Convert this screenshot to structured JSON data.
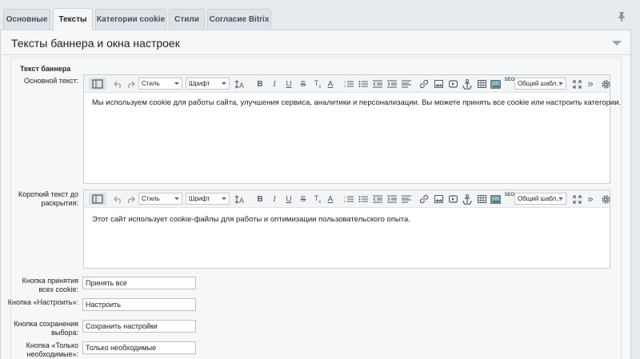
{
  "tabs": [
    {
      "label": "Основные",
      "active": false
    },
    {
      "label": "Тексты",
      "active": true
    },
    {
      "label": "Категории cookie",
      "active": false
    },
    {
      "label": "Стили",
      "active": false
    },
    {
      "label": "Согласие Bitrix",
      "active": false
    }
  ],
  "panel": {
    "title": "Тексты баннера и окна настроек"
  },
  "section": {
    "label": "Текст баннера"
  },
  "editors": [
    {
      "label": "Основной текст:",
      "style_select": "Стиль",
      "font_select": "Шрифт",
      "template_select": "Общий шабл...",
      "content": "Мы используем cookie для работы сайта, улучшения сервиса, аналитики и персонализации. Вы можете принять все cookie или настроить категории."
    },
    {
      "label": "Короткий текст до раскрытия:",
      "style_select": "Стиль",
      "font_select": "Шрифт",
      "template_select": "Общий шабл...",
      "content": "Этот сайт использует cookie-файлы для работы и оптимизации пользовательского опыта."
    }
  ],
  "fields": [
    {
      "label": "Кнопка принятия всех cookie:",
      "value": "Принять все"
    },
    {
      "label": "Кнопка «Настроить»:",
      "value": "Настроить"
    },
    {
      "label": "Кнопка сохранения выбора:",
      "value": "Сохранить настройки"
    },
    {
      "label": "Кнопка «Только необходимые»:",
      "value": "Только необходимые"
    }
  ],
  "toolbar_icons": [
    "editor-mode-icon",
    "undo-icon",
    "redo-icon",
    "font-size-icon",
    "bold-icon",
    "italic-icon",
    "underline-icon",
    "strikethrough-icon",
    "clear-format-icon",
    "text-color-icon",
    "ordered-list-icon",
    "unordered-list-icon",
    "outdent-icon",
    "indent-icon",
    "align-icon",
    "link-icon",
    "image-icon",
    "video-icon",
    "anchor-icon",
    "table-icon",
    "smiley-icon",
    "seo-icon",
    "fullscreen-icon",
    "more-icon",
    "settings-icon"
  ],
  "toolbar_text": {
    "seo": "SEO"
  }
}
